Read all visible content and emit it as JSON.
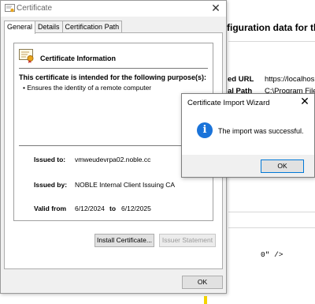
{
  "background": {
    "heading": "figuration data for the",
    "rows": [
      {
        "label": "ed URL",
        "value": "https://localhos"
      },
      {
        "label": "al Path",
        "value": "C:\\Program File"
      }
    ],
    "snippet": "0\" />"
  },
  "certificate_window": {
    "title": "Certificate",
    "close_glyph": "✕",
    "tabs": [
      {
        "label": "General"
      },
      {
        "label": "Details"
      },
      {
        "label": "Certification Path"
      }
    ],
    "info_title": "Certificate Information",
    "intended_heading": "This certificate is intended for the following purpose(s):",
    "purposes": [
      "• Ensures the identity of a remote computer"
    ],
    "issued_to_label": "Issued to:",
    "issued_to_value": "vmweudevrpa02.noble.cc",
    "issued_by_label": "Issued by:",
    "issued_by_value": "NOBLE Internal Client Issuing CA",
    "valid_from_label": "Valid from",
    "valid_from_value": "6/12/2024",
    "valid_to_label": "to",
    "valid_to_value": "6/12/2025",
    "install_button": "Install Certificate...",
    "issuer_button": "Issuer Statement",
    "ok_button": "OK"
  },
  "import_wizard": {
    "title": "Certificate Import Wizard",
    "close_glyph": "✕",
    "message": "The import was successful.",
    "ok_button": "OK"
  }
}
